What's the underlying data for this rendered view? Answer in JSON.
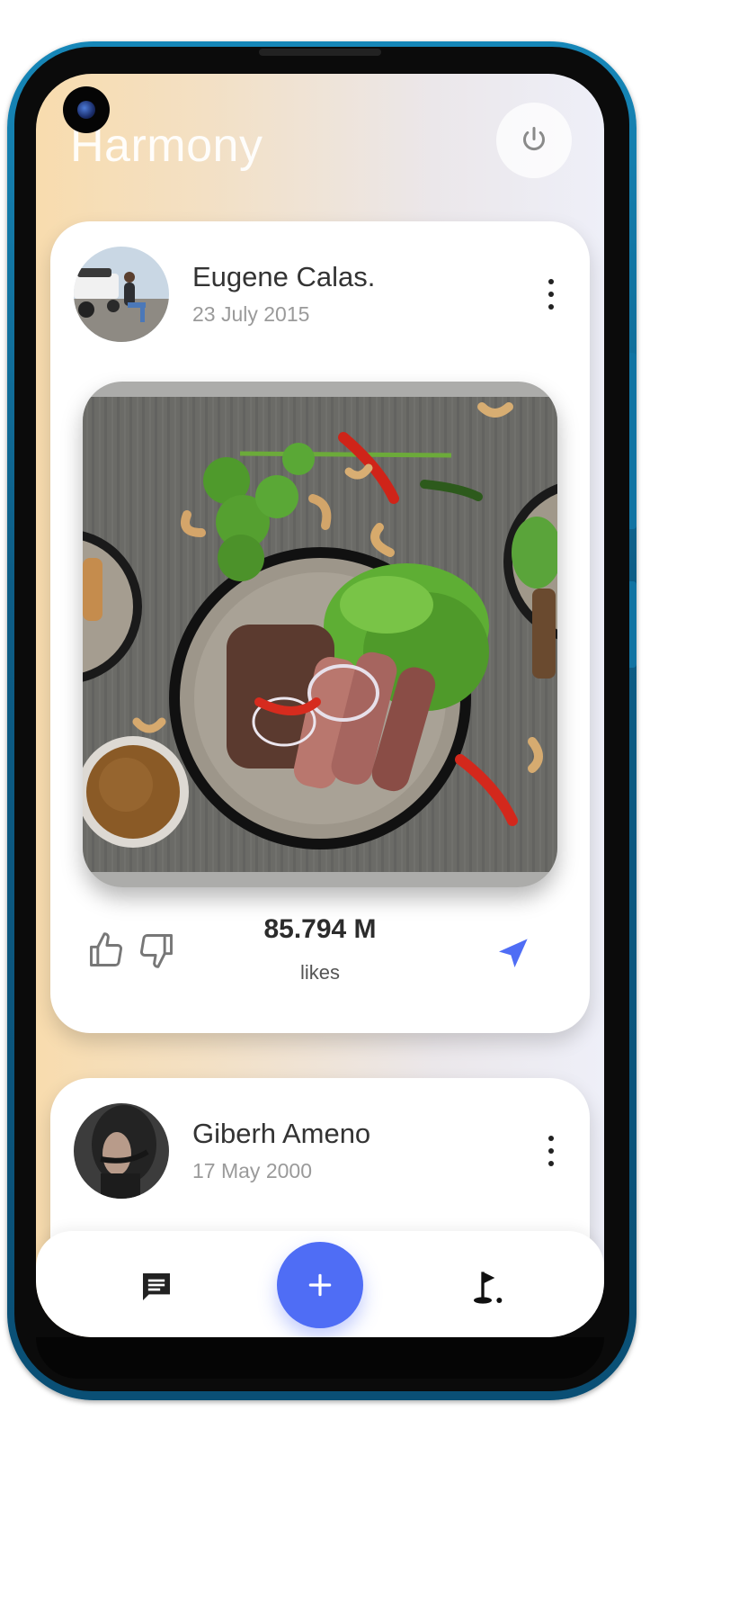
{
  "app": {
    "title": "Harmony"
  },
  "posts": [
    {
      "author": "Eugene Calas.",
      "date": "23 July 2015",
      "likes_count": "85.794 M",
      "likes_label": "likes"
    },
    {
      "author": "Giberh Ameno",
      "date": "17 May 2000"
    }
  ],
  "icons": {
    "power": "power-icon",
    "more": "more-vertical-icon",
    "like": "thumbs-up-icon",
    "dislike": "thumbs-down-icon",
    "send": "send-icon",
    "chat": "chat-icon",
    "add": "plus-icon",
    "golf": "golf-icon"
  },
  "colors": {
    "accent": "#4f6df5",
    "frame": "#1687b8"
  }
}
